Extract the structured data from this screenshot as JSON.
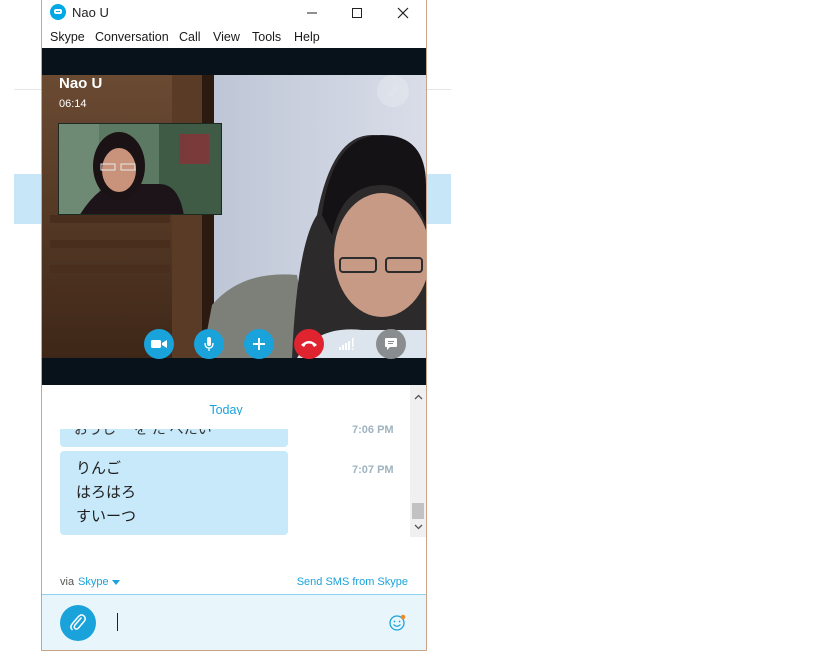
{
  "window": {
    "title": "Nao U",
    "controls": [
      "minimize",
      "maximize",
      "close"
    ]
  },
  "menu": [
    "Skype",
    "Conversation",
    "Call",
    "View",
    "Tools",
    "Help"
  ],
  "call": {
    "caller_name": "Nao U",
    "timer": "06:14",
    "controls": [
      "video-camera-icon",
      "microphone-icon",
      "add-icon",
      "end-call-icon",
      "signal-strength-icon",
      "chat-bubble-icon"
    ],
    "colors": {
      "accent": "#1aa3db",
      "end_call": "#e0242f",
      "call_bg": "#08121b"
    }
  },
  "chat": {
    "day_label": "Today",
    "messages": [
      {
        "text": "おうし ーを た べたい",
        "time": "7:06 PM",
        "lines": []
      },
      {
        "text": "",
        "time": "7:07 PM",
        "lines": [
          "りんご",
          "はろはろ",
          "すいーつ"
        ]
      }
    ],
    "bubble_color": "#c7e9fa"
  },
  "footer": {
    "via_label": "via",
    "via_link": "Skype",
    "sms_link": "Send SMS from Skype"
  },
  "composer": {
    "value": "",
    "icons": [
      "paperclip-icon",
      "emoticon-icon"
    ]
  }
}
